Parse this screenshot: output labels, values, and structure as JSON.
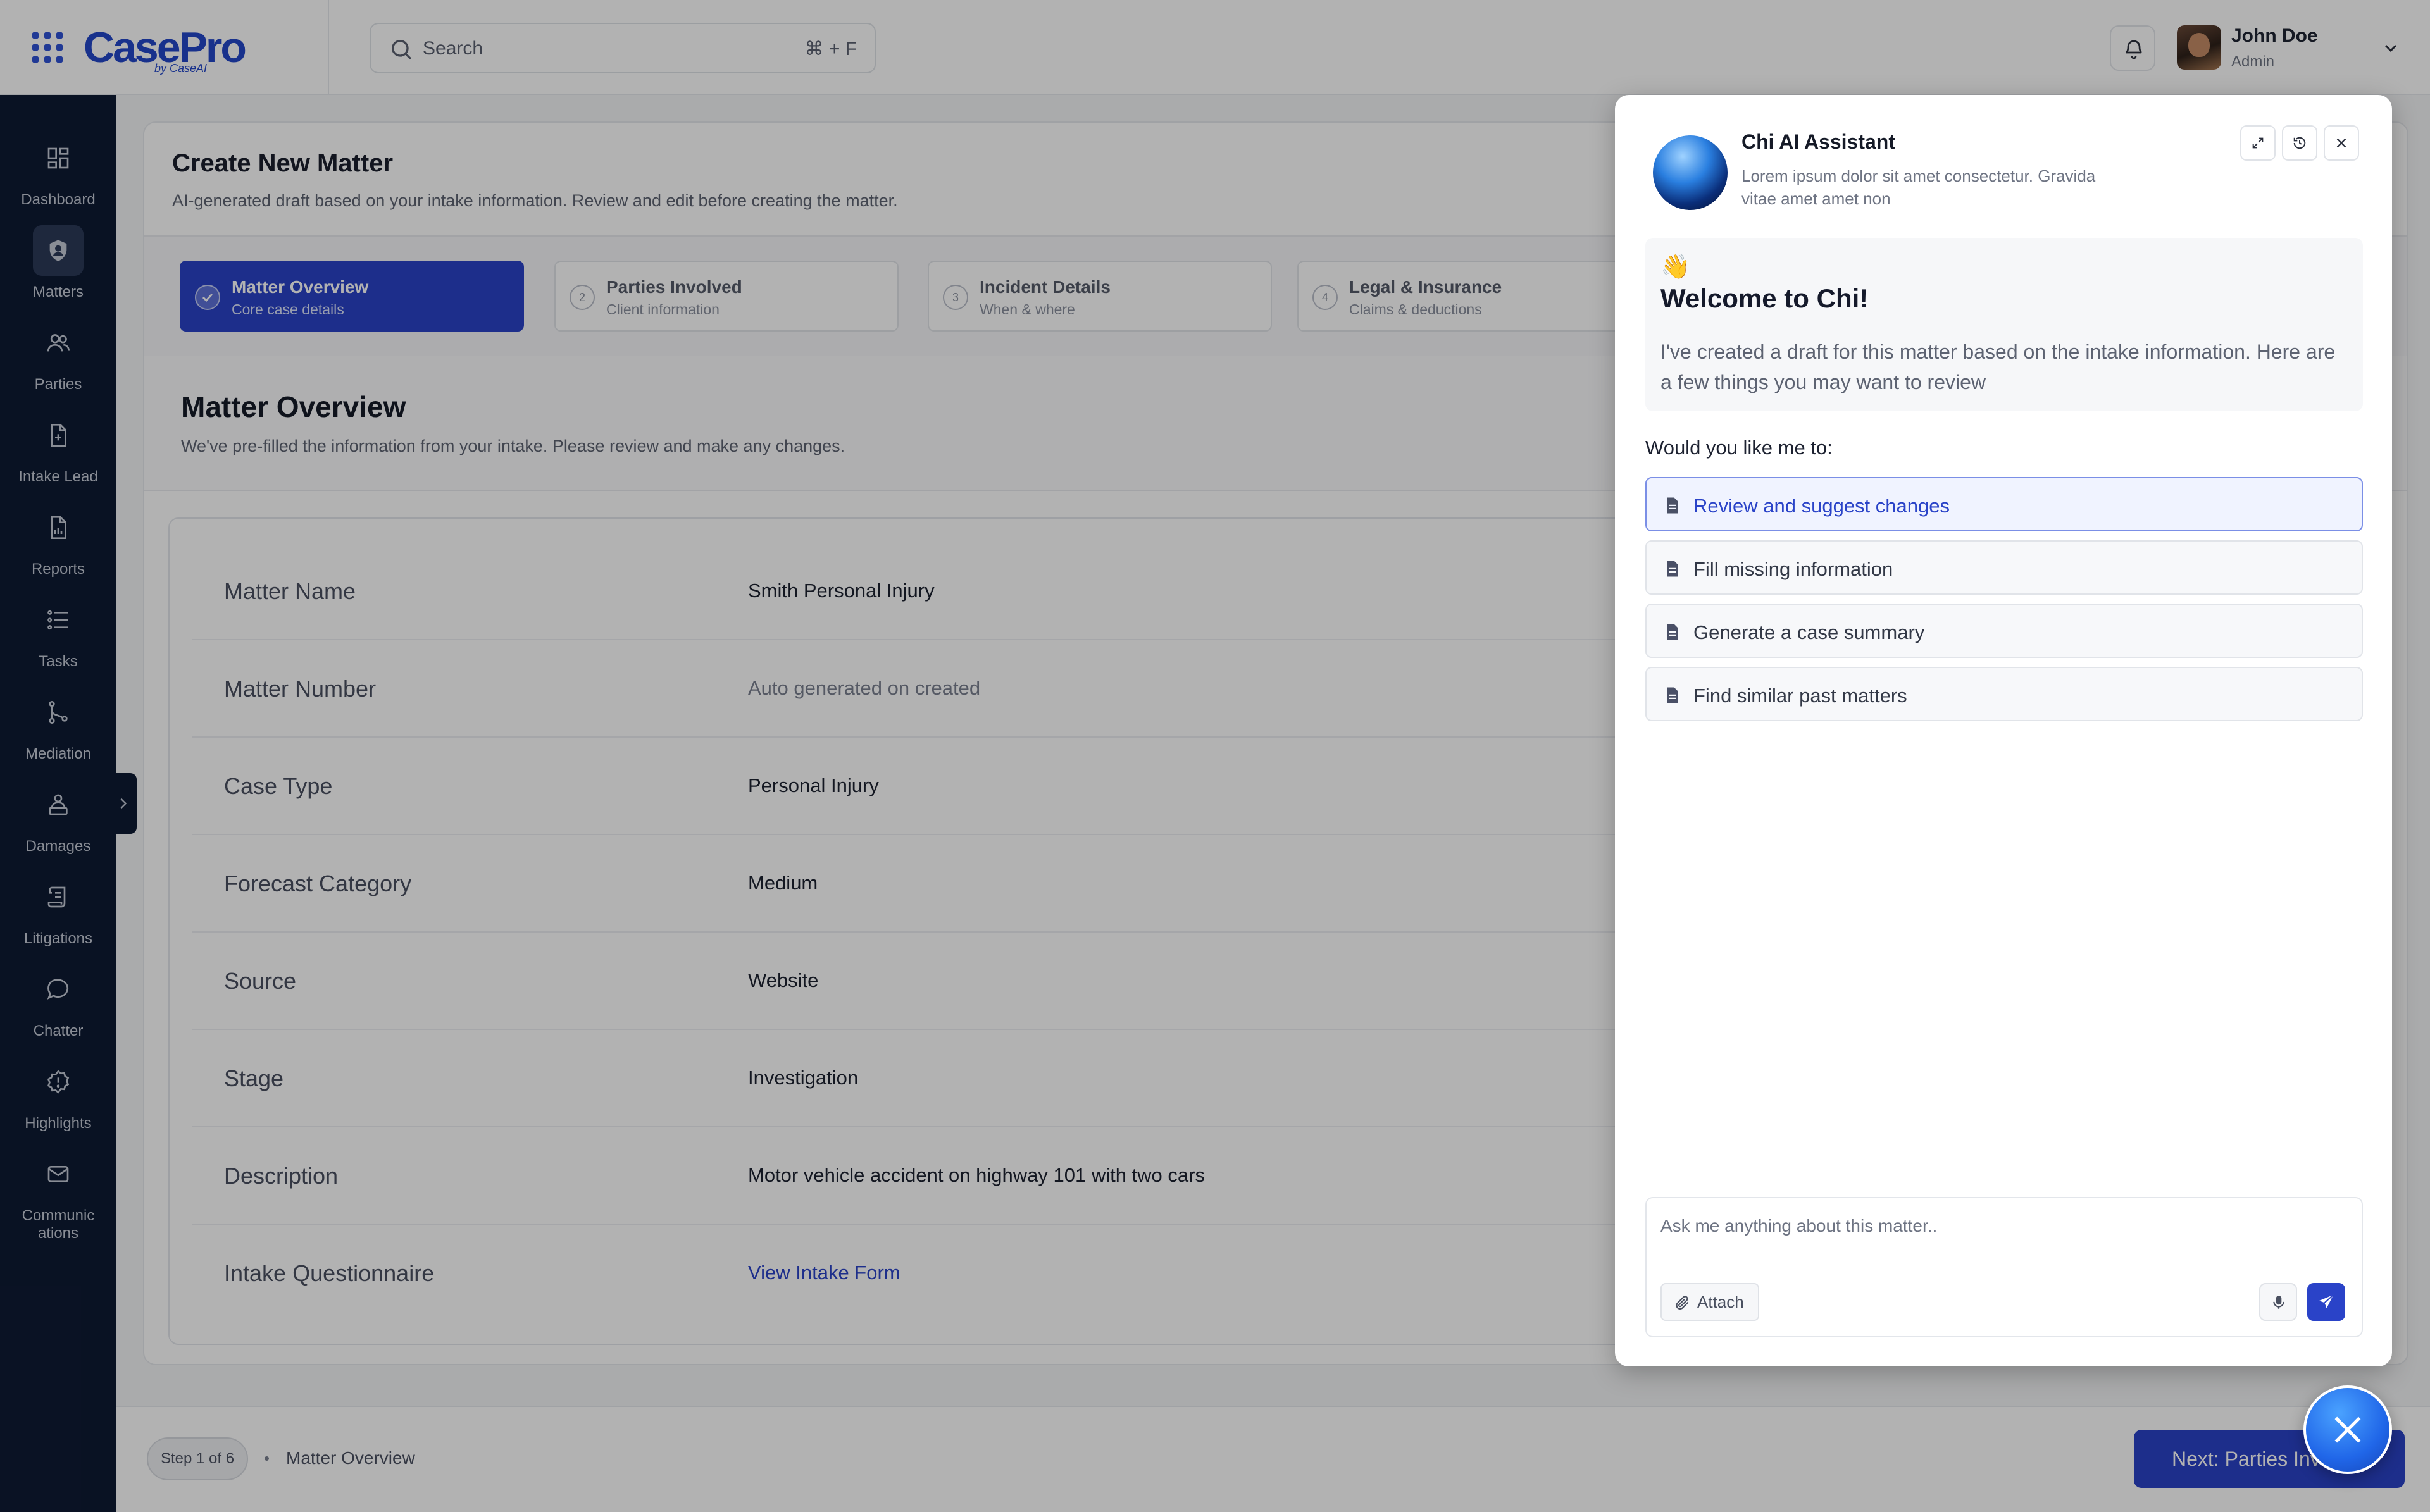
{
  "brand": {
    "logo_text": "CasePro",
    "logo_sub": "by CaseAI",
    "accent_color": "#2a43c8"
  },
  "topbar": {
    "search_placeholder": "Search",
    "search_shortcut": "⌘ + F",
    "user": {
      "name": "John Doe",
      "role": "Admin"
    }
  },
  "sidebar": {
    "items": [
      {
        "label": "Dashboard",
        "icon": "dashboard-icon"
      },
      {
        "label": "Matters",
        "icon": "briefcase-icon",
        "active": true
      },
      {
        "label": "Parties",
        "icon": "users-icon"
      },
      {
        "label": "Intake Lead",
        "icon": "file-icon"
      },
      {
        "label": "Reports",
        "icon": "report-icon"
      },
      {
        "label": "Tasks",
        "icon": "list-icon"
      },
      {
        "label": "Mediation",
        "icon": "branch-icon"
      },
      {
        "label": "Damages",
        "icon": "damages-icon"
      },
      {
        "label": "Litigations",
        "icon": "scroll-icon"
      },
      {
        "label": "Chatter",
        "icon": "chat-icon"
      },
      {
        "label": "Highlights",
        "icon": "alert-badge-icon"
      },
      {
        "label": "Communic ations",
        "icon": "mail-icon"
      }
    ]
  },
  "page": {
    "title": "Create New Matter",
    "subtitle": "AI-generated draft based on your intake information. Review and edit before creating the matter."
  },
  "steps": [
    {
      "number": "1",
      "title": "Matter Overview",
      "desc": "Core case details",
      "active": true
    },
    {
      "number": "2",
      "title": "Parties Involved",
      "desc": "Client information"
    },
    {
      "number": "3",
      "title": "Incident Details",
      "desc": "When & where"
    },
    {
      "number": "4",
      "title": "Legal & Insurance",
      "desc": "Claims & deductions"
    }
  ],
  "section": {
    "title": "Matter Overview",
    "subtitle": "We've pre-filled the information from your intake. Please review and make any changes."
  },
  "fields": [
    {
      "label": "Matter Name",
      "value": "Smith Personal Injury"
    },
    {
      "label": "Matter Number",
      "value": "Auto generated on created",
      "muted": true
    },
    {
      "label": "Case Type",
      "value": "Personal Injury"
    },
    {
      "label": "Forecast Category",
      "value": "Medium"
    },
    {
      "label": "Source",
      "value": "Website"
    },
    {
      "label": "Stage",
      "value": "Investigation"
    },
    {
      "label": "Description",
      "value": "Motor vehicle accident on highway 101 with two cars"
    },
    {
      "label": "Intake Questionnaire",
      "value": "View Intake Form",
      "link": true
    }
  ],
  "footer": {
    "step_pill": "Step 1 of 6",
    "crumb": "Matter Overview",
    "next_label": "Next: Parties Involved"
  },
  "chi": {
    "title": "Chi AI Assistant",
    "subtitle": "Lorem ipsum dolor sit amet consectetur. Gravida vitae amet amet non",
    "wave": "👋",
    "welcome_title": "Welcome to Chi!",
    "welcome_text": "I've created a draft for this matter based on the intake information. Here are a few things you may want to review",
    "prompt_label": "Would you like me to:",
    "suggestions": [
      {
        "label": "Review and suggest changes",
        "selected": true
      },
      {
        "label": "Fill missing information"
      },
      {
        "label": "Generate a case summary"
      },
      {
        "label": "Find similar past matters"
      }
    ],
    "composer_placeholder": "Ask me anything about this matter..",
    "attach_label": "Attach"
  }
}
